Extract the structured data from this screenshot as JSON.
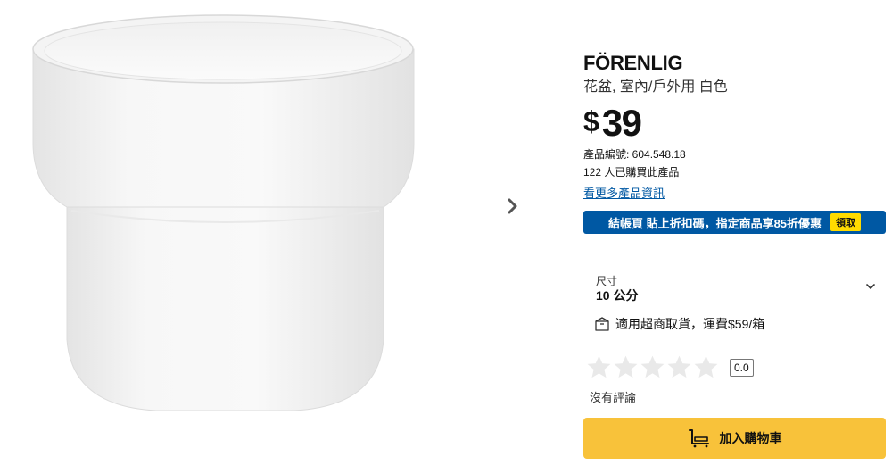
{
  "product": {
    "name": "FÖRENLIG",
    "description": "花盆, 室內/戶外用 白色",
    "price_currency": "$",
    "price_value": "39",
    "article_number": "產品編號: 604.548.18",
    "bought_count": "122 人已購買此產品",
    "more_info_link": "看更多產品資訊"
  },
  "gallery": {
    "next_icon": "chevron-right-icon",
    "image_icon": "white-plant-pot"
  },
  "promo": {
    "text": "結帳頁 貼上折扣碼，指定商品享85折優惠",
    "claim_label": "領取",
    "bg_color": "#0058a3",
    "claim_color": "#ffdb00"
  },
  "size": {
    "label": "尺寸",
    "value": "10 公分",
    "icon": "chevron-down-icon"
  },
  "delivery": {
    "icon": "package-icon",
    "text": "適用超商取貨，運費$59/箱"
  },
  "rating": {
    "value": "0.0",
    "stars_total": 5,
    "stars_filled": 0,
    "reviews_text": "沒有評論"
  },
  "cart": {
    "label": "加入購物車",
    "icon": "shopping-cart-icon",
    "color": "#f8c23a"
  }
}
